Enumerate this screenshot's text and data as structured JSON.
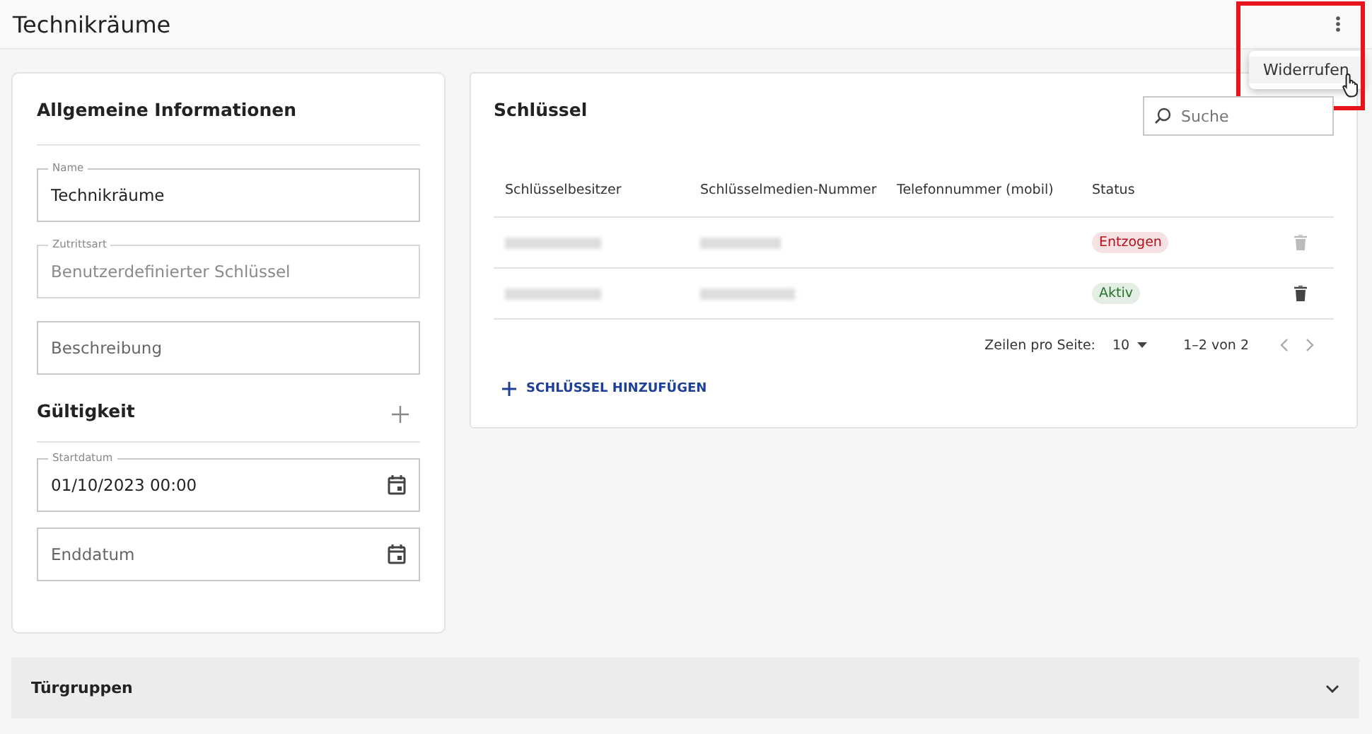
{
  "page_title": "Technikräume",
  "menu": {
    "items": [
      {
        "label": "Widerrufen",
        "hovered": true
      }
    ]
  },
  "general": {
    "title": "Allgemeine Informationen",
    "fields": [
      {
        "label": "Name",
        "value": "Technikräume",
        "disabled": false
      },
      {
        "label": "Zutrittsart",
        "value": "Benutzerdefinierter Schlüssel",
        "disabled": true
      },
      {
        "placeholder": "Beschreibung",
        "disabled": false
      }
    ]
  },
  "validity": {
    "title": "Gültigkeit",
    "fields": [
      {
        "label": "Startdatum",
        "value": "01/10/2023 00:00"
      },
      {
        "placeholder": "Enddatum"
      }
    ]
  },
  "keys": {
    "title": "Schlüssel",
    "search": {
      "placeholder": "Suche"
    },
    "columns": [
      "Schlüsselbesitzer",
      "Schlüsselmedien-Nummer",
      "Telefonnummer (mobil)",
      "Status"
    ],
    "rows": [
      {
        "status": "Entzogen",
        "color": "#b3121c",
        "delete_disabled": true
      },
      {
        "status": "Aktiv",
        "color": "#27752b",
        "delete_disabled": false
      }
    ],
    "rows_per_page_label": "Zeilen pro Seite:",
    "rows_per_page": "10",
    "range": "1–2 von 2",
    "add_button": "SCHLÜSSEL HINZUFÜGEN"
  },
  "accordion": {
    "title": "Türgruppen",
    "expanded": false
  }
}
